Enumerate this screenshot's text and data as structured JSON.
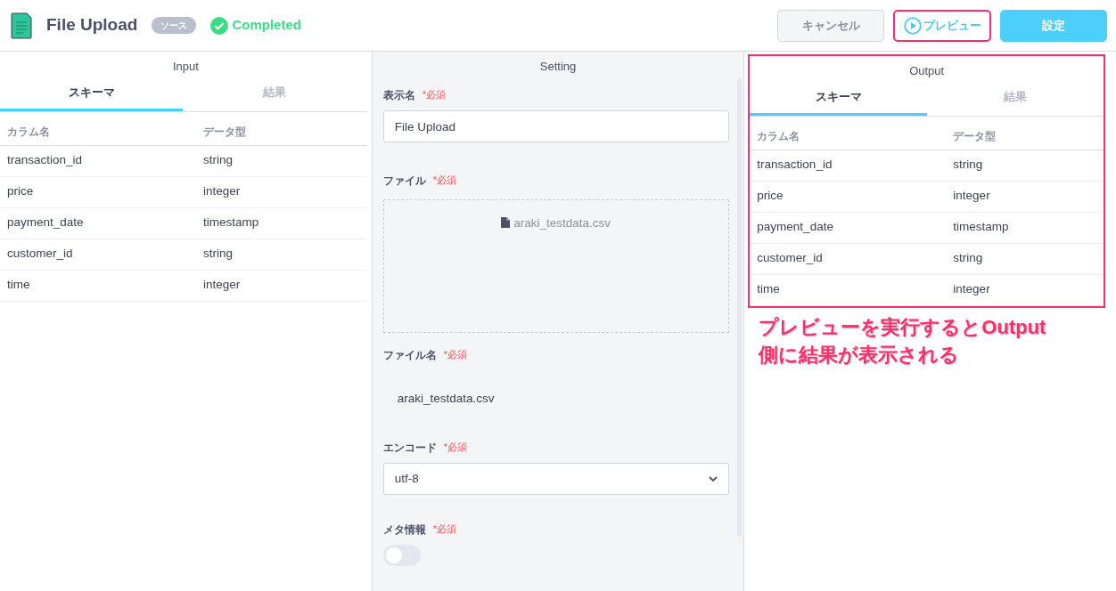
{
  "header": {
    "title": "File Upload",
    "badge": "ソース",
    "status": {
      "text": "Completed",
      "kind": "success"
    },
    "buttons": [
      {
        "label": "キャンセル",
        "kind": "cancel",
        "highlighted": false
      },
      {
        "label": "プレビュー",
        "kind": "preview",
        "highlighted": true
      },
      {
        "label": "設定",
        "kind": "primary",
        "highlighted": false
      }
    ]
  },
  "input": {
    "title": "Input",
    "tabs": [
      {
        "label": "スキーマ",
        "selected": true
      },
      {
        "label": "結果",
        "selected": false
      }
    ],
    "columns": [
      "カラム名",
      "データ型"
    ],
    "rows": [
      [
        "transaction_id",
        "string"
      ],
      [
        "price",
        "integer"
      ],
      [
        "payment_date",
        "timestamp"
      ],
      [
        "customer_id",
        "string"
      ],
      [
        "time",
        "integer"
      ]
    ]
  },
  "setting": {
    "title": "Setting",
    "fields": [
      {
        "kind": "text",
        "label": "表示名",
        "required": "*必須",
        "value": "File Upload"
      },
      {
        "kind": "file",
        "label": "ファイル",
        "required": "*必須",
        "value": "araki_testdata.csv"
      },
      {
        "kind": "static",
        "label": "ファイル名",
        "required": "*必須",
        "value": "araki_testdata.csv"
      },
      {
        "kind": "select",
        "label": "エンコード",
        "required": "*必須",
        "value": "utf-8"
      },
      {
        "kind": "toggle",
        "label": "メタ情報",
        "required": "*必須",
        "on": false
      }
    ]
  },
  "output": {
    "title": "Output",
    "highlighted": true,
    "tabs": [
      {
        "label": "スキーマ",
        "selected": true
      },
      {
        "label": "結果",
        "selected": false
      }
    ],
    "columns": [
      "カラム名",
      "データ型"
    ],
    "rows": [
      [
        "transaction_id",
        "string"
      ],
      [
        "price",
        "integer"
      ],
      [
        "payment_date",
        "timestamp"
      ],
      [
        "customer_id",
        "string"
      ],
      [
        "time",
        "integer"
      ]
    ]
  },
  "annotation": {
    "lines": [
      "プレビューを実行するとOutput",
      "側に結果が表示される"
    ]
  }
}
